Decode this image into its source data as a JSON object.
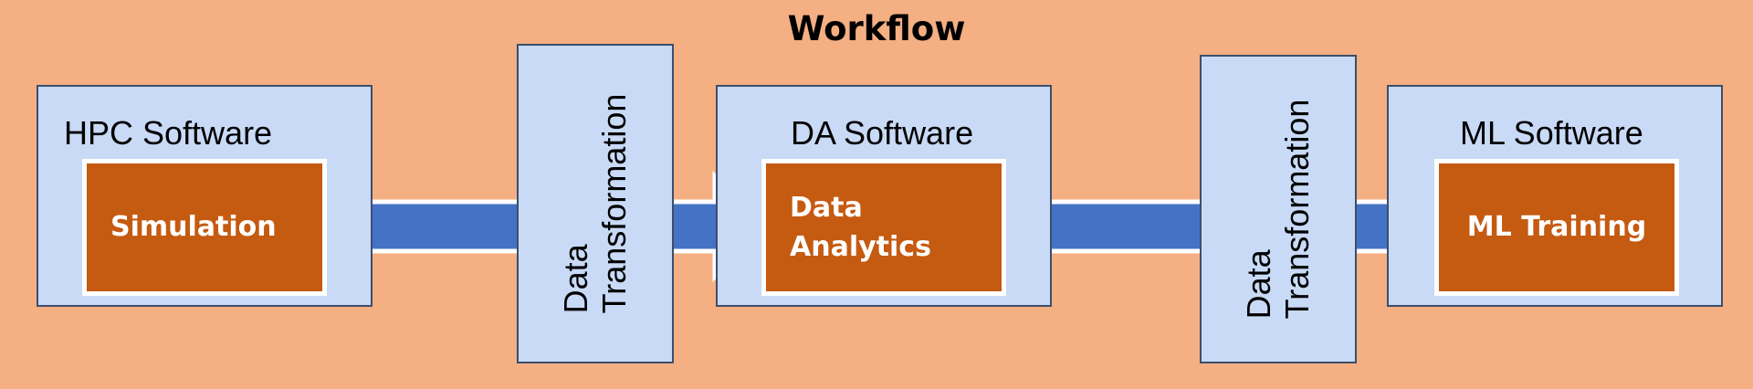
{
  "title": "Workflow",
  "stages": [
    {
      "software": "HPC Software",
      "process": [
        "Simulation"
      ]
    },
    {
      "software": "DA Software",
      "process": [
        "Data",
        "Analytics"
      ]
    },
    {
      "software": "ML Software",
      "process": [
        "ML Training"
      ]
    }
  ],
  "transformations": [
    {
      "line1": "Data",
      "line2": "Transformation"
    },
    {
      "line1": "Data",
      "line2": "Transformation"
    }
  ],
  "colors": {
    "background": "#F4AF83",
    "container": "#C9DAF6",
    "process": "#C55A11",
    "arrow": "#4472C4"
  }
}
